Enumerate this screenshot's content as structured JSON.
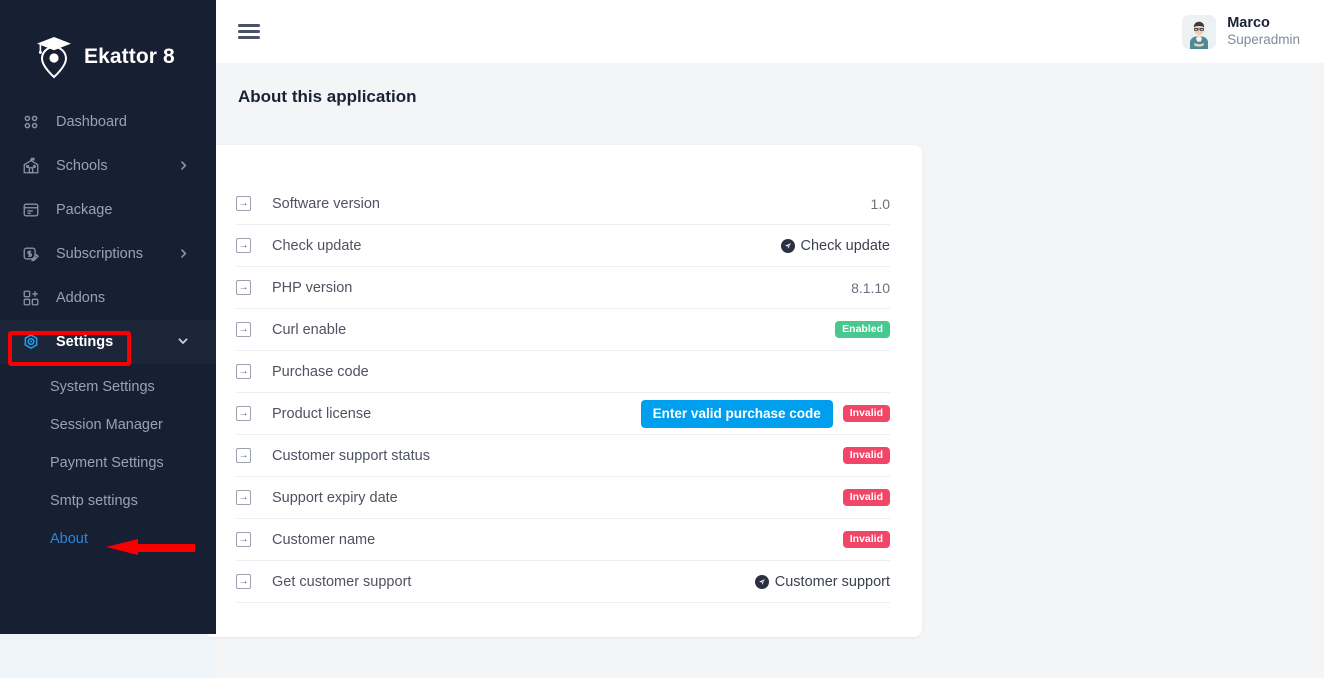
{
  "brand": {
    "name": "Ekattor 8",
    "logo_icon": "graduation-cap-pin-logo"
  },
  "sidebar": {
    "items": [
      {
        "label": "Dashboard",
        "icon": "grid-dots-icon",
        "has_caret": false,
        "active": false
      },
      {
        "label": "Schools",
        "icon": "school-icon",
        "has_caret": true,
        "active": false
      },
      {
        "label": "Package",
        "icon": "package-card-icon",
        "has_caret": false,
        "active": false
      },
      {
        "label": "Subscriptions",
        "icon": "subscription-icon",
        "has_caret": true,
        "active": false
      },
      {
        "label": "Addons",
        "icon": "grid-plus-icon",
        "has_caret": false,
        "active": false
      },
      {
        "label": "Settings",
        "icon": "gear-icon",
        "has_caret": true,
        "active": true
      }
    ],
    "submenu": [
      {
        "label": "System Settings",
        "current": false
      },
      {
        "label": "Session Manager",
        "current": false
      },
      {
        "label": "Payment Settings",
        "current": false
      },
      {
        "label": "Smtp settings",
        "current": false
      },
      {
        "label": "About",
        "current": true
      }
    ],
    "accent_active": "#1da1f2",
    "background": "#171f33"
  },
  "topbar": {
    "menu_icon": "hamburger-icon",
    "profile": {
      "name": "Marco",
      "role": "Superadmin",
      "avatar_icon": "user-avatar"
    }
  },
  "page": {
    "title": "About this application"
  },
  "about_rows": [
    {
      "icon": "arrow-in-box-icon",
      "label": "Software version",
      "value": "1.0",
      "value_type": "text"
    },
    {
      "icon": "arrow-in-box-icon",
      "label": "Check update",
      "value": "Check update",
      "value_type": "link"
    },
    {
      "icon": "arrow-in-box-icon",
      "label": "PHP version",
      "value": "8.1.10",
      "value_type": "text"
    },
    {
      "icon": "arrow-in-box-icon",
      "label": "Curl enable",
      "value": "Enabled",
      "value_type": "badge-enabled"
    },
    {
      "icon": "arrow-in-box-icon",
      "label": "Purchase code",
      "value": "",
      "value_type": "empty"
    },
    {
      "icon": "arrow-in-box-icon",
      "label": "Product license",
      "value": "Invalid",
      "value_type": "button-badge",
      "button_label": "Enter valid purchase code"
    },
    {
      "icon": "arrow-in-box-icon",
      "label": "Customer support status",
      "value": "Invalid",
      "value_type": "badge-invalid"
    },
    {
      "icon": "arrow-in-box-icon",
      "label": "Support expiry date",
      "value": "Invalid",
      "value_type": "badge-invalid"
    },
    {
      "icon": "arrow-in-box-icon",
      "label": "Customer name",
      "value": "Invalid",
      "value_type": "badge-invalid"
    },
    {
      "icon": "arrow-in-box-icon",
      "label": "Get customer support",
      "value": "Customer support",
      "value_type": "link"
    }
  ],
  "colors": {
    "badge_enabled": "#48c78e",
    "badge_invalid": "#f14668",
    "button_blue": "#009fee",
    "annotation_red": "#f80000",
    "sidebar_bg": "#171f33",
    "page_bg": "#f4f5f7"
  },
  "annotations": {
    "highlight_box_target": "Settings",
    "arrow_target": "About"
  }
}
